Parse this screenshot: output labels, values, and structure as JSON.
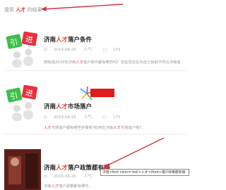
{
  "search": {
    "prefix": "搜索",
    "keyword": "人才",
    "suffix": "的结果"
  },
  "articles": [
    {
      "title_pre": "济南",
      "title_hl": "人才",
      "title_post": "落户条件",
      "date": "2019-08-26",
      "views": "人气：",
      "count": "173",
      "excerpt_pre": "想知道2019年济南",
      "excerpt_hl": "人才",
      "excerpt_post": "落户条件都有哪些吗？您是否还在为自己目前不符合济南落",
      "thumb_icon": "user-with-sign-icon"
    },
    {
      "title_pre": "济南",
      "title_hl": "人才",
      "title_post": "市场落户",
      "date": "2019-08-26",
      "views": "人气：",
      "count": "175",
      "excerpt_pre": "",
      "excerpt_hl": "人才",
      "excerpt_post": "市场落户都有哪些步骤呢?如何在济南",
      "excerpt_hl2": "人才",
      "excerpt_post2": "市场落户呢?...",
      "thumb_icon": "user-with-sign-icon"
    },
    {
      "title_pre": "济南",
      "title_hl": "人才",
      "title_post": "落户政策都有哪",
      "date": "2019-08-26",
      "views": "人气：",
      "count": "",
      "excerpt_pre": "济南",
      "excerpt_hl": "人才",
      "excerpt_post": "落户政策都有哪些...",
      "thumb_icon": "photo-thumbnail"
    }
  ],
  "tooltip": "济南<font color='red'>人才</font>落户政策都有哪",
  "colors": {
    "highlight": "#e23a3a",
    "arrow": "#d8323a"
  }
}
